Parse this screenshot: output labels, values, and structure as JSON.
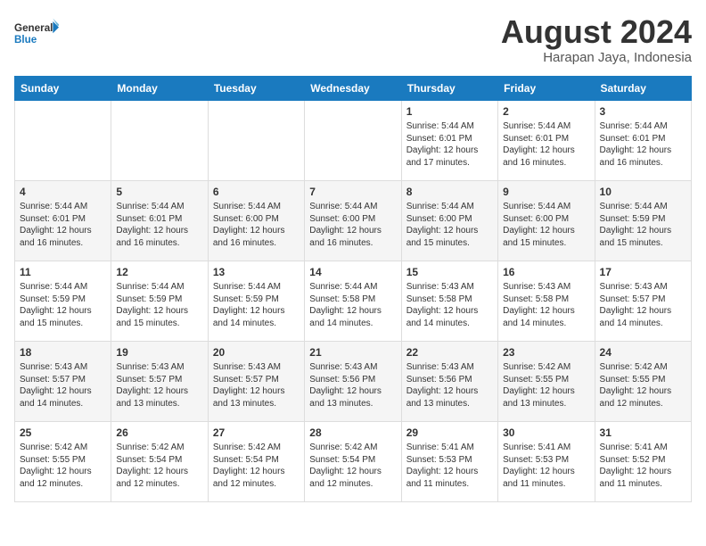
{
  "logo": {
    "line1": "General",
    "line2": "Blue"
  },
  "title": "August 2024",
  "subtitle": "Harapan Jaya, Indonesia",
  "headers": [
    "Sunday",
    "Monday",
    "Tuesday",
    "Wednesday",
    "Thursday",
    "Friday",
    "Saturday"
  ],
  "weeks": [
    [
      {
        "day": "",
        "info": ""
      },
      {
        "day": "",
        "info": ""
      },
      {
        "day": "",
        "info": ""
      },
      {
        "day": "",
        "info": ""
      },
      {
        "day": "1",
        "info": "Sunrise: 5:44 AM\nSunset: 6:01 PM\nDaylight: 12 hours\nand 17 minutes."
      },
      {
        "day": "2",
        "info": "Sunrise: 5:44 AM\nSunset: 6:01 PM\nDaylight: 12 hours\nand 16 minutes."
      },
      {
        "day": "3",
        "info": "Sunrise: 5:44 AM\nSunset: 6:01 PM\nDaylight: 12 hours\nand 16 minutes."
      }
    ],
    [
      {
        "day": "4",
        "info": "Sunrise: 5:44 AM\nSunset: 6:01 PM\nDaylight: 12 hours\nand 16 minutes."
      },
      {
        "day": "5",
        "info": "Sunrise: 5:44 AM\nSunset: 6:01 PM\nDaylight: 12 hours\nand 16 minutes."
      },
      {
        "day": "6",
        "info": "Sunrise: 5:44 AM\nSunset: 6:00 PM\nDaylight: 12 hours\nand 16 minutes."
      },
      {
        "day": "7",
        "info": "Sunrise: 5:44 AM\nSunset: 6:00 PM\nDaylight: 12 hours\nand 16 minutes."
      },
      {
        "day": "8",
        "info": "Sunrise: 5:44 AM\nSunset: 6:00 PM\nDaylight: 12 hours\nand 15 minutes."
      },
      {
        "day": "9",
        "info": "Sunrise: 5:44 AM\nSunset: 6:00 PM\nDaylight: 12 hours\nand 15 minutes."
      },
      {
        "day": "10",
        "info": "Sunrise: 5:44 AM\nSunset: 5:59 PM\nDaylight: 12 hours\nand 15 minutes."
      }
    ],
    [
      {
        "day": "11",
        "info": "Sunrise: 5:44 AM\nSunset: 5:59 PM\nDaylight: 12 hours\nand 15 minutes."
      },
      {
        "day": "12",
        "info": "Sunrise: 5:44 AM\nSunset: 5:59 PM\nDaylight: 12 hours\nand 15 minutes."
      },
      {
        "day": "13",
        "info": "Sunrise: 5:44 AM\nSunset: 5:59 PM\nDaylight: 12 hours\nand 14 minutes."
      },
      {
        "day": "14",
        "info": "Sunrise: 5:44 AM\nSunset: 5:58 PM\nDaylight: 12 hours\nand 14 minutes."
      },
      {
        "day": "15",
        "info": "Sunrise: 5:43 AM\nSunset: 5:58 PM\nDaylight: 12 hours\nand 14 minutes."
      },
      {
        "day": "16",
        "info": "Sunrise: 5:43 AM\nSunset: 5:58 PM\nDaylight: 12 hours\nand 14 minutes."
      },
      {
        "day": "17",
        "info": "Sunrise: 5:43 AM\nSunset: 5:57 PM\nDaylight: 12 hours\nand 14 minutes."
      }
    ],
    [
      {
        "day": "18",
        "info": "Sunrise: 5:43 AM\nSunset: 5:57 PM\nDaylight: 12 hours\nand 14 minutes."
      },
      {
        "day": "19",
        "info": "Sunrise: 5:43 AM\nSunset: 5:57 PM\nDaylight: 12 hours\nand 13 minutes."
      },
      {
        "day": "20",
        "info": "Sunrise: 5:43 AM\nSunset: 5:57 PM\nDaylight: 12 hours\nand 13 minutes."
      },
      {
        "day": "21",
        "info": "Sunrise: 5:43 AM\nSunset: 5:56 PM\nDaylight: 12 hours\nand 13 minutes."
      },
      {
        "day": "22",
        "info": "Sunrise: 5:43 AM\nSunset: 5:56 PM\nDaylight: 12 hours\nand 13 minutes."
      },
      {
        "day": "23",
        "info": "Sunrise: 5:42 AM\nSunset: 5:55 PM\nDaylight: 12 hours\nand 13 minutes."
      },
      {
        "day": "24",
        "info": "Sunrise: 5:42 AM\nSunset: 5:55 PM\nDaylight: 12 hours\nand 12 minutes."
      }
    ],
    [
      {
        "day": "25",
        "info": "Sunrise: 5:42 AM\nSunset: 5:55 PM\nDaylight: 12 hours\nand 12 minutes."
      },
      {
        "day": "26",
        "info": "Sunrise: 5:42 AM\nSunset: 5:54 PM\nDaylight: 12 hours\nand 12 minutes."
      },
      {
        "day": "27",
        "info": "Sunrise: 5:42 AM\nSunset: 5:54 PM\nDaylight: 12 hours\nand 12 minutes."
      },
      {
        "day": "28",
        "info": "Sunrise: 5:42 AM\nSunset: 5:54 PM\nDaylight: 12 hours\nand 12 minutes."
      },
      {
        "day": "29",
        "info": "Sunrise: 5:41 AM\nSunset: 5:53 PM\nDaylight: 12 hours\nand 11 minutes."
      },
      {
        "day": "30",
        "info": "Sunrise: 5:41 AM\nSunset: 5:53 PM\nDaylight: 12 hours\nand 11 minutes."
      },
      {
        "day": "31",
        "info": "Sunrise: 5:41 AM\nSunset: 5:52 PM\nDaylight: 12 hours\nand 11 minutes."
      }
    ]
  ]
}
